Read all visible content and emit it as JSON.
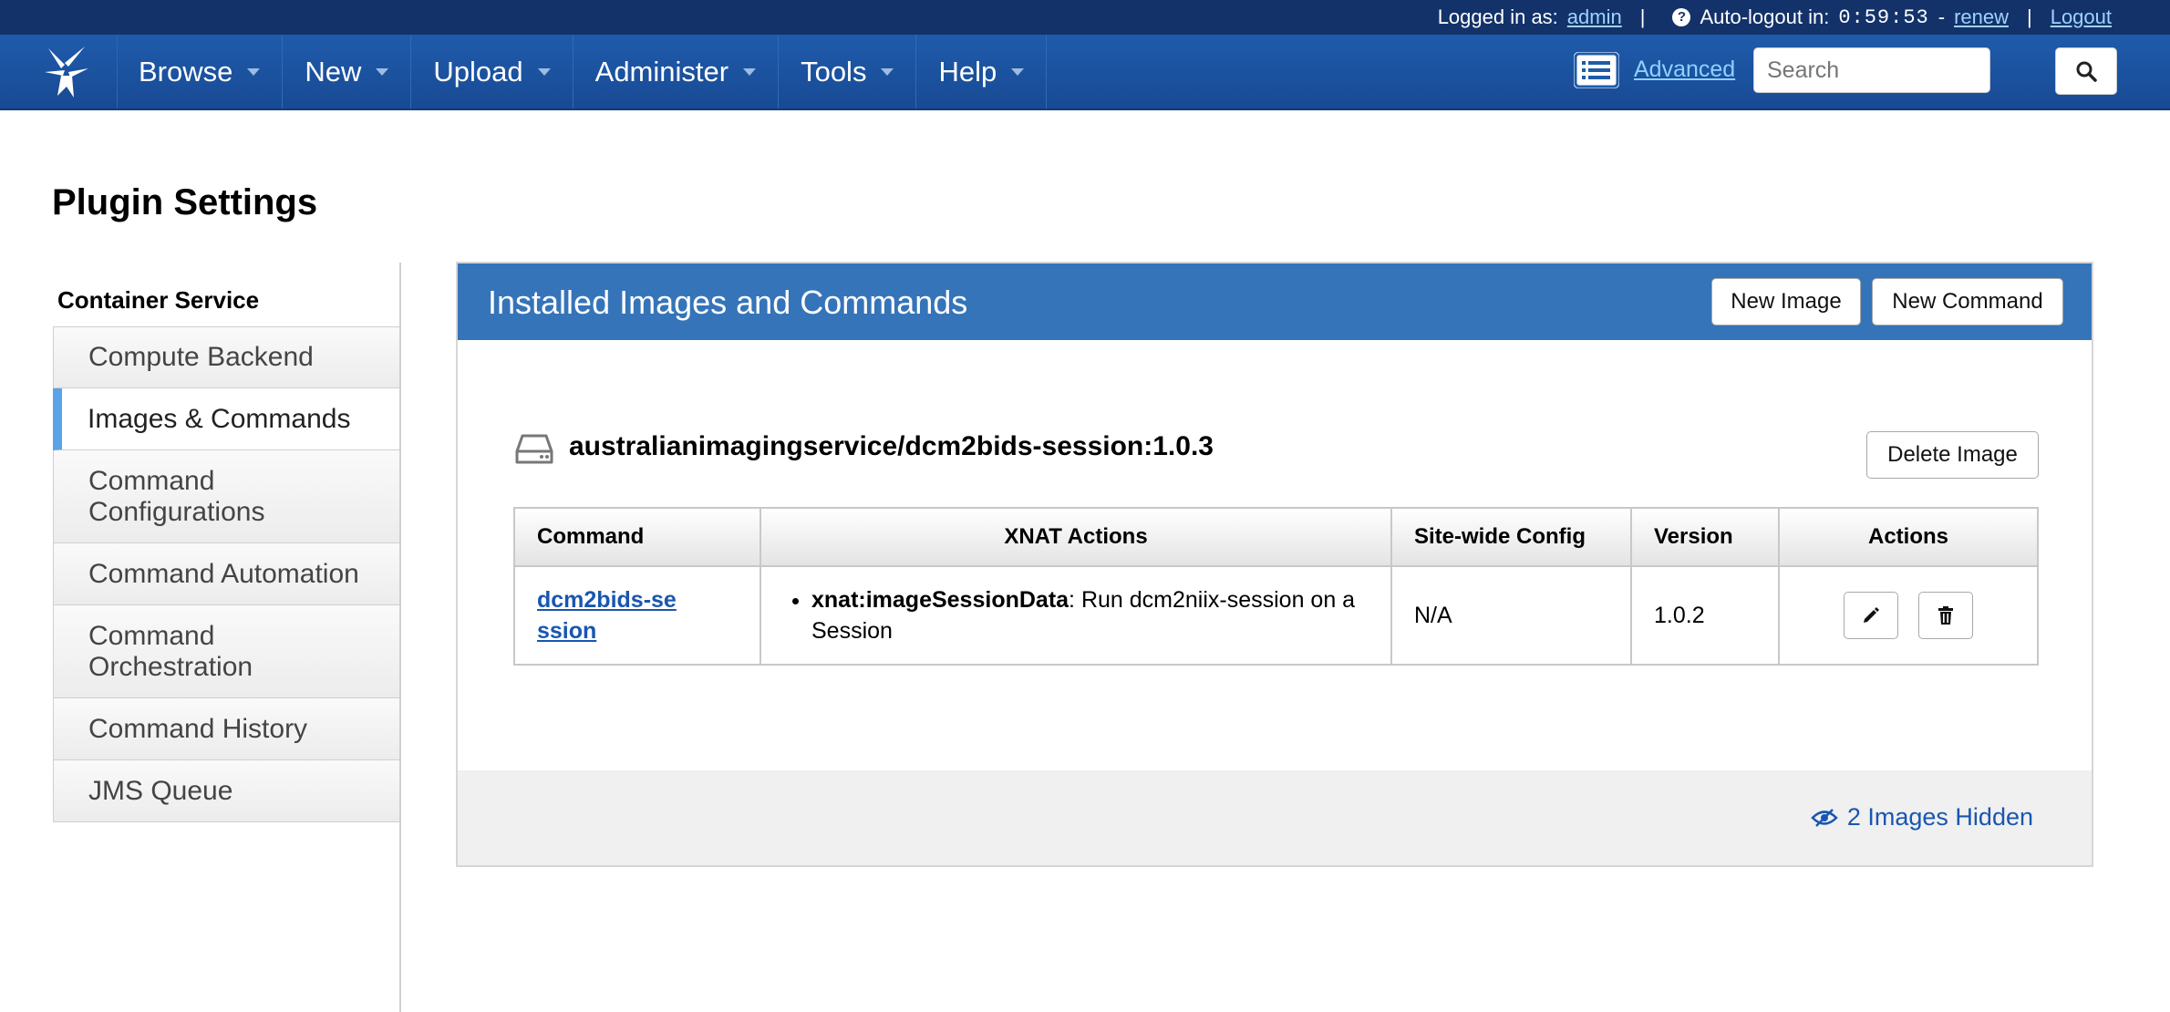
{
  "topbar": {
    "logged_in_label": "Logged in as:",
    "username": "admin",
    "autologout_label": "Auto-logout in:",
    "timer": "0:59:53",
    "timer_dash": "-",
    "renew": "renew",
    "logout": "Logout",
    "separator": "|",
    "help_glyph": "?"
  },
  "nav": {
    "menu": [
      "Browse",
      "New",
      "Upload",
      "Administer",
      "Tools",
      "Help"
    ],
    "advanced": "Advanced",
    "search_placeholder": "Search"
  },
  "page": {
    "title": "Plugin Settings"
  },
  "sidebar": {
    "heading": "Container Service",
    "items": [
      {
        "label": "Compute Backend",
        "active": false
      },
      {
        "label": "Images & Commands",
        "active": true
      },
      {
        "label": "Command Configurations",
        "active": false
      },
      {
        "label": "Command Automation",
        "active": false
      },
      {
        "label": "Command Orchestration",
        "active": false
      },
      {
        "label": "Command History",
        "active": false
      },
      {
        "label": "JMS Queue",
        "active": false
      }
    ]
  },
  "panel": {
    "title": "Installed Images and Commands",
    "new_image": "New Image",
    "new_command": "New Command",
    "image": {
      "name": "australianimagingservice/dcm2bids-session:1.0.3",
      "delete": "Delete Image"
    },
    "table": {
      "headers": [
        "Command",
        "XNAT Actions",
        "Site-wide Config",
        "Version",
        "Actions"
      ],
      "rows": [
        {
          "command": "dcm2bids-session",
          "xnat_action_key": "xnat:imageSessionData",
          "xnat_action_text": ": Run dcm2niix-session on a Session",
          "site_config": "N/A",
          "version": "1.0.2"
        }
      ]
    },
    "hidden": "2 Images Hidden"
  },
  "colors": {
    "topbar": "#13326a",
    "navbar": "#1f5bab",
    "panel_header": "#3574b9",
    "sidebar_active": "#5aa3e6"
  }
}
